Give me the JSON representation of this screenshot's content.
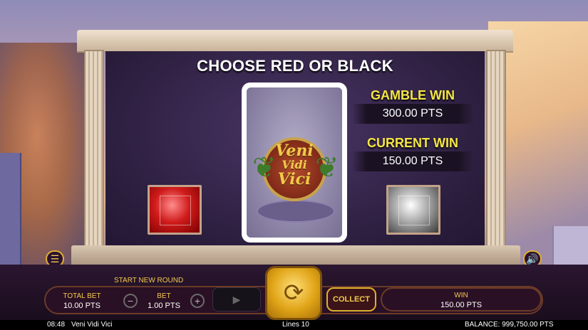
{
  "game": {
    "title": "CHOOSE RED OR BLACK",
    "card_logo": {
      "line1": "Veni",
      "line2": "Vidi",
      "line3": "Vici"
    },
    "gamble_win_label": "GAMBLE WIN",
    "gamble_win_value": "300.00 PTS",
    "current_win_label": "CURRENT WIN",
    "current_win_value": "150.00 PTS",
    "red_choice": "red-gem",
    "black_choice": "black-gem"
  },
  "controls": {
    "start_new_round": "START NEW ROUND",
    "total_bet_label": "TOTAL BET",
    "total_bet_value": "10.00 PTS",
    "bet_label": "BET",
    "bet_value": "1.00 PTS",
    "minus": "−",
    "plus": "+",
    "collect_label": "COLLECT",
    "win_label": "WIN",
    "win_value": "150.00 PTS",
    "menu_icon": "☰",
    "sound_icon": "🔊",
    "spin_icon": "⟳",
    "autoplay_icon": "▶"
  },
  "status_bar": {
    "time": "08:48",
    "game_name": "Veni Vidi Vici",
    "lines": "Lines 10",
    "balance": "BALANCE: 999,750.00 PTS"
  }
}
